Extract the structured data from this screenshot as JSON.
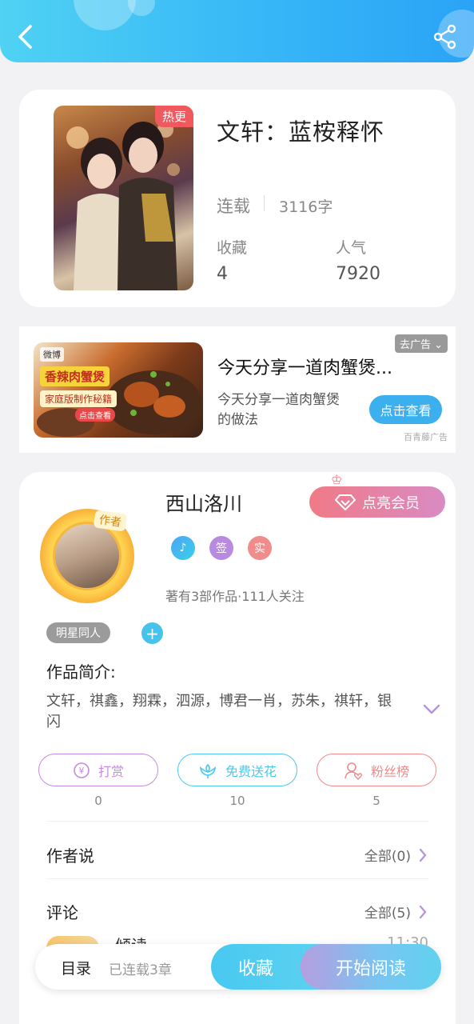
{
  "header": {
    "back_icon": "back-arrow-icon",
    "share_icon": "share-icon"
  },
  "book": {
    "badge": "热更",
    "title": "文轩：蓝桉释怀",
    "status": "连载",
    "word_count": "3116字",
    "collect_label": "收藏",
    "collect_value": "4",
    "popularity_label": "人气",
    "popularity_value": "7920"
  },
  "ad": {
    "weibo": "微博",
    "image_tag": "香辣肉蟹煲",
    "image_sub": "家庭版制作秘籍",
    "image_stamp": "点击查看",
    "remove_label": "去广告",
    "title": "今天分享一道肉蟹煲...",
    "description": "今天分享一道肉蟹煲的做法",
    "button": "点击查看",
    "source": "百青藤广告"
  },
  "author": {
    "avatar_tag": "作者",
    "name": "西山洛川",
    "vip_button": "点亮会员",
    "badge_music": "♪",
    "badge_sign": "签",
    "badge_real": "实",
    "meta": "著有3部作品·111人关注",
    "tag": "明星同人",
    "add_tag": "+"
  },
  "intro": {
    "title": "作品简介:",
    "text": "文轩，祺鑫，翔霖，泗源，博君一肖，苏朱，祺轩，银闪"
  },
  "actions": [
    {
      "label": "打赏",
      "count": "0",
      "icon": "coin-icon",
      "color": "#c58be0"
    },
    {
      "label": "免费送花",
      "count": "10",
      "icon": "flower-icon",
      "color": "#4cc9ec"
    },
    {
      "label": "粉丝榜",
      "count": "5",
      "icon": "fan-icon",
      "color": "#ef8b8b"
    }
  ],
  "author_says": {
    "title": "作者说",
    "more": "全部(0)"
  },
  "comments": {
    "title": "评论",
    "more": "全部(5)",
    "peek_user": "倾读",
    "peek_time": "11:30"
  },
  "bottom_bar": {
    "toc": "目录",
    "chapters": "已连载3章",
    "collect": "收藏",
    "read": "开始阅读"
  }
}
